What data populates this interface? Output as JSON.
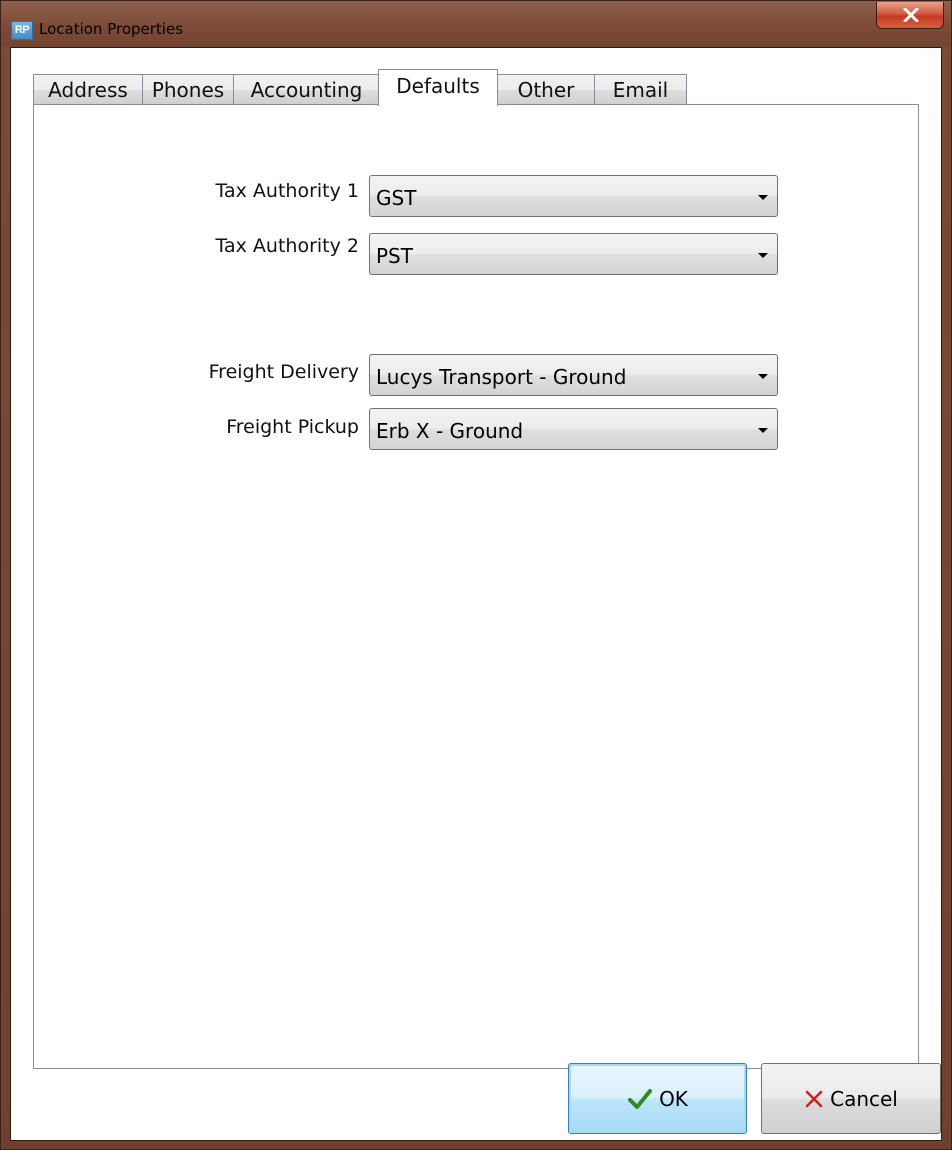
{
  "window": {
    "title": "Location Properties",
    "app_icon_text": "RP",
    "close_icon": "close-icon"
  },
  "tabs": [
    {
      "label": "Address",
      "selected": false
    },
    {
      "label": "Phones",
      "selected": false
    },
    {
      "label": "Accounting",
      "selected": false
    },
    {
      "label": "Defaults",
      "selected": true
    },
    {
      "label": "Other",
      "selected": false
    },
    {
      "label": "Email",
      "selected": false
    }
  ],
  "defaults": {
    "tax_authority_1": {
      "label": "Tax Authority 1",
      "value": "GST"
    },
    "tax_authority_2": {
      "label": "Tax Authority 2",
      "value": "PST"
    },
    "freight_delivery": {
      "label": "Freight Delivery",
      "value": "Lucys Transport - Ground"
    },
    "freight_pickup": {
      "label": "Freight Pickup",
      "value": "Erb X - Ground"
    }
  },
  "buttons": {
    "ok": {
      "label": "OK",
      "icon": "checkmark-icon",
      "icon_color": "#2e8b1f"
    },
    "cancel": {
      "label": "Cancel",
      "icon": "x-icon",
      "icon_color": "#d21f1f"
    }
  },
  "colors": {
    "titlebar": "#7c4c38",
    "default_button_border": "#3c7fb1"
  }
}
